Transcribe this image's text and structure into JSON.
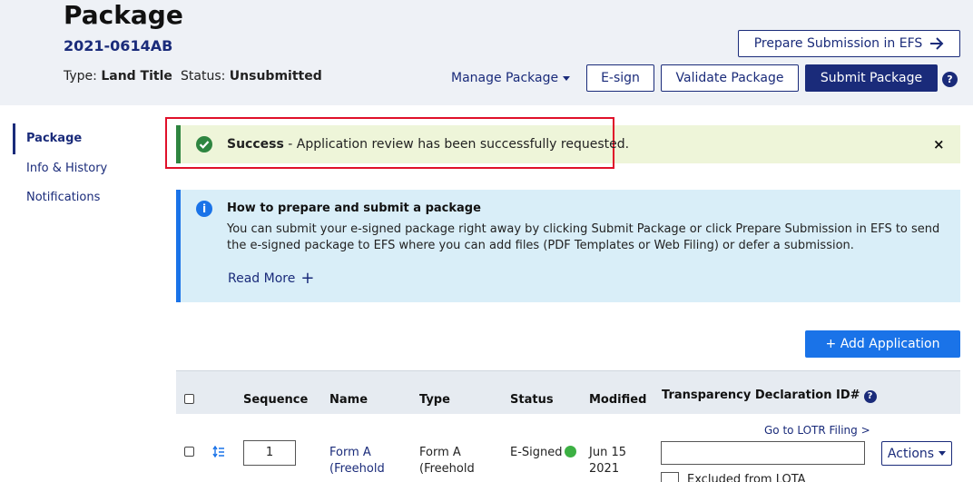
{
  "header": {
    "title": "Package",
    "package_id": "2021-0614AB",
    "type_label": "Type:",
    "type_value": "Land Title",
    "status_label": "Status:",
    "status_value": "Unsubmitted",
    "prepare_button": "Prepare Submission in EFS",
    "manage_package": "Manage Package",
    "esign_button": "E-sign",
    "validate_button": "Validate Package",
    "submit_button": "Submit Package",
    "help": "?"
  },
  "sidebar": {
    "items": [
      {
        "label": "Package",
        "active": true
      },
      {
        "label": "Info & History",
        "active": false
      },
      {
        "label": "Notifications",
        "active": false
      }
    ]
  },
  "success_alert": {
    "strong": "Success",
    "message": " - Application review has been successfully requested.",
    "close": "×"
  },
  "info_alert": {
    "icon": "i",
    "heading": "How to prepare and submit a package",
    "body": "You can submit your e-signed package right away by clicking Submit Package or click Prepare Submission in EFS to send the e-signed package to EFS where you can add files (PDF Templates or Web Filing) or defer a submission.",
    "read_more": "Read More",
    "read_more_icon": "+"
  },
  "add_application": "+ Add Application",
  "table": {
    "headers": {
      "sequence": "Sequence",
      "name": "Name",
      "type": "Type",
      "status": "Status",
      "modified": "Modified",
      "declaration": "Transparency Declaration ID#"
    },
    "rows": [
      {
        "sequence": "1",
        "name_line1": "Form A",
        "name_line2": "(Freehold",
        "type_line1": "Form A",
        "type_line2": "(Freehold",
        "status": "E-Signed",
        "modified_line1": "Jun 15",
        "modified_line2": "2021",
        "lotr_link": "Go to LOTR Filing >",
        "actions": "Actions",
        "excluded_label": "Excluded from LOTA"
      }
    ]
  },
  "colors": {
    "navy": "#1a2b7a",
    "blue": "#1a73e8",
    "success_green": "#2e8540",
    "highlight_red": "#e0102a"
  }
}
